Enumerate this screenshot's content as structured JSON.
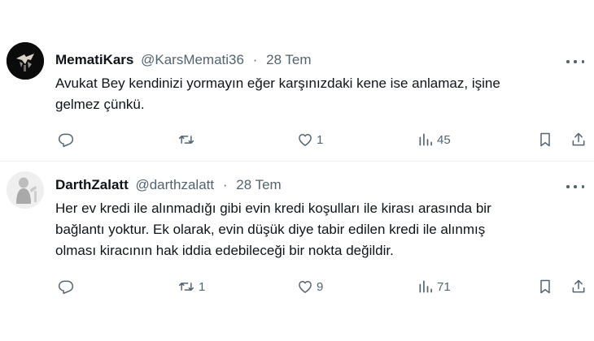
{
  "tweets": [
    {
      "author": {
        "name": "MematiKars",
        "handle": "@KarsMemati36"
      },
      "date": "28 Tem",
      "text_lines": [
        "Avukat Bey kendinizi yormayın eğer karşınızdaki kene ise anlamaz, işine",
        "gelmez çünkü."
      ],
      "stats": {
        "replies": "",
        "retweets": "",
        "likes": "1",
        "views": "45"
      }
    },
    {
      "author": {
        "name": "DarthZalatt",
        "handle": "@darthzalatt"
      },
      "date": "28 Tem",
      "text_lines": [
        "Her ev kredi ile alınmadığı gibi evin kredi koşulları ile kirası arasında bir",
        "bağlantı yoktur. Ek olarak, evin düşük diye tabir edilen kredi ile alınmış",
        "olması kiracının hak iddia edebileceği bir nokta değildir."
      ],
      "stats": {
        "replies": "",
        "retweets": "1",
        "likes": "9",
        "views": "71"
      }
    }
  ],
  "icons": [
    "more-icon",
    "reply-icon",
    "retweet-icon",
    "like-icon",
    "views-icon",
    "bookmark-icon",
    "share-icon"
  ],
  "colors": {
    "text": "#0f1419",
    "secondary": "#536471",
    "divider": "#eff3f4",
    "background": "#ffffff"
  }
}
